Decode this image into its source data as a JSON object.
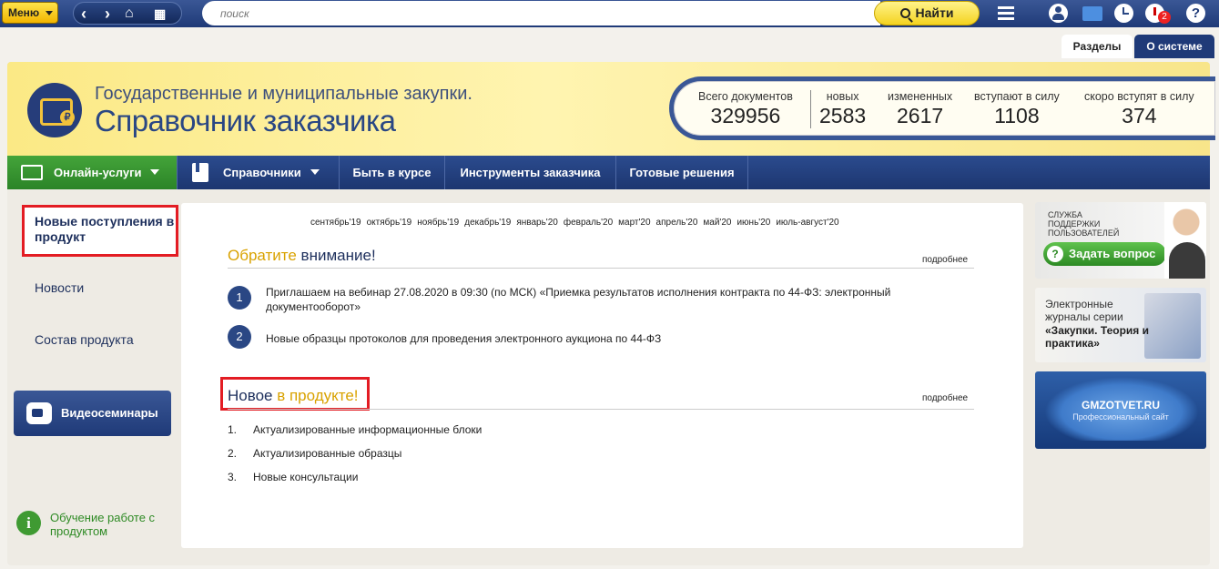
{
  "topbar": {
    "menu_label": "Меню",
    "search_placeholder": "поиск",
    "find_label": "Найти",
    "notifications_count": "2",
    "help_label": "?"
  },
  "tabs": {
    "sections": "Разделы",
    "about": "О системе"
  },
  "banner": {
    "subtitle": "Государственные и муниципальные закупки.",
    "title": "Справочник заказчика",
    "stats": [
      {
        "label": "Всего документов",
        "value": "329956"
      },
      {
        "label": "новых",
        "value": "2583"
      },
      {
        "label": "измененных",
        "value": "2617"
      },
      {
        "label": "вступают в силу",
        "value": "1108"
      },
      {
        "label": "скоро вступят в силу",
        "value": "374"
      }
    ]
  },
  "nav": {
    "online": "Онлайн-услуги",
    "reference": "Справочники",
    "news": "Быть в курсе",
    "tools": "Инструменты заказчика",
    "solutions": "Готовые решения"
  },
  "sidebar": {
    "new_arrivals": "Новые поступления в продукт",
    "news": "Новости",
    "composition": "Состав продукта",
    "video": "Видеосеминары",
    "training": "Обучение работе с продуктом"
  },
  "main": {
    "months": [
      "сентябрь'19",
      "октябрь'19",
      "ноябрь'19",
      "декабрь'19",
      "январь'20",
      "февраль'20",
      "март'20",
      "апрель'20",
      "май'20",
      "июнь'20",
      "июль-август'20"
    ],
    "attention_part1": "Обратите",
    "attention_part2": " внимание!",
    "more": "подробнее",
    "announcements": [
      {
        "num": "1",
        "text": "Приглашаем на вебинар 27.08.2020 в 09:30 (по МСК) «Приемка результатов исполнения контракта по 44-ФЗ: электронный документооборот»"
      },
      {
        "num": "2",
        "text": "Новые образцы протоколов для проведения электронного аукциона по 44-ФЗ"
      }
    ],
    "new_part1": "Новое ",
    "new_part2": "в продукте!",
    "new_items": [
      {
        "num": "1.",
        "text": "Актуализированные информационные блоки"
      },
      {
        "num": "2.",
        "text": "Актуализированные образцы"
      },
      {
        "num": "3.",
        "text": "Новые консультации"
      }
    ]
  },
  "right": {
    "support_text": "Служба поддержки пользователей",
    "ask_button": "Задать вопрос",
    "journal_text": "Электронные журналы серии",
    "journal_bold": "«Закупки. Теория и практика»",
    "gmz_title": "GMZOTVET.RU",
    "gmz_sub": "Профессиональный сайт"
  },
  "colors": {
    "nav_blue": "#1f3a78",
    "accent_yellow": "#f2b500",
    "green": "#2e8a24",
    "highlight_red": "#e31c23"
  }
}
